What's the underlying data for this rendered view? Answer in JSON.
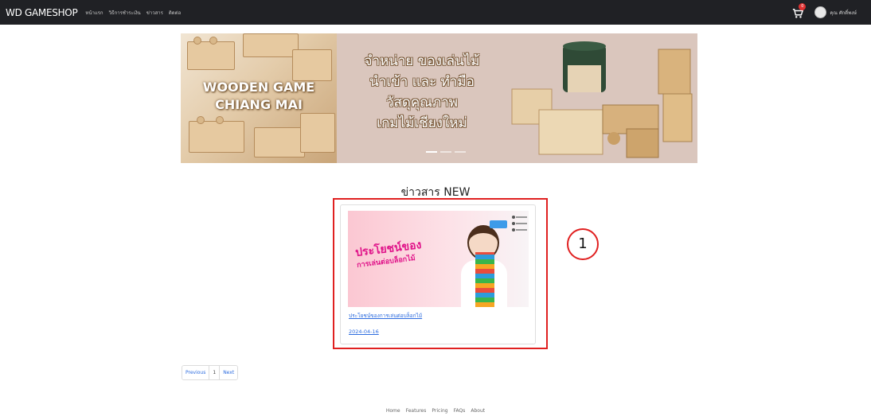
{
  "navbar": {
    "brand": "WD GAMESHOP",
    "links": [
      "หน้าแรก",
      "วิธีการชำระเงิน",
      "ข่าวสาร",
      "ติดต่อ"
    ],
    "cart_count": "0",
    "user_name": "คุณ ศักดิ์พงษ์"
  },
  "banner": {
    "left_text_line1": "WOODEN GAME",
    "left_text_line2": "CHIANG MAI",
    "mid_lines": [
      "จำหน่าย ของเล่นไม้",
      "นำเข้า และ ทำมือ",
      "วัสดุคุณภาพ",
      "เกมไม้เชียงใหม่"
    ]
  },
  "news": {
    "section_title": "ข่าวสาร NEW",
    "card": {
      "image_text_line1": "ประโยชน์ของ",
      "image_text_line2": "การเล่นต่อบล็อกไม้",
      "title": "ประโยชน์ของการเล่นต่อบล็อกไม้",
      "date": "2024-04-16"
    }
  },
  "annotation": {
    "label": "1"
  },
  "pagination": {
    "previous": "Previous",
    "current": "1",
    "next": "Next"
  },
  "footer": {
    "links": [
      "Home",
      "Features",
      "Pricing",
      "FAQs",
      "About"
    ]
  },
  "colors": {
    "navbar": "#202125",
    "highlight": "#e02020",
    "link": "#2d6cdf"
  }
}
